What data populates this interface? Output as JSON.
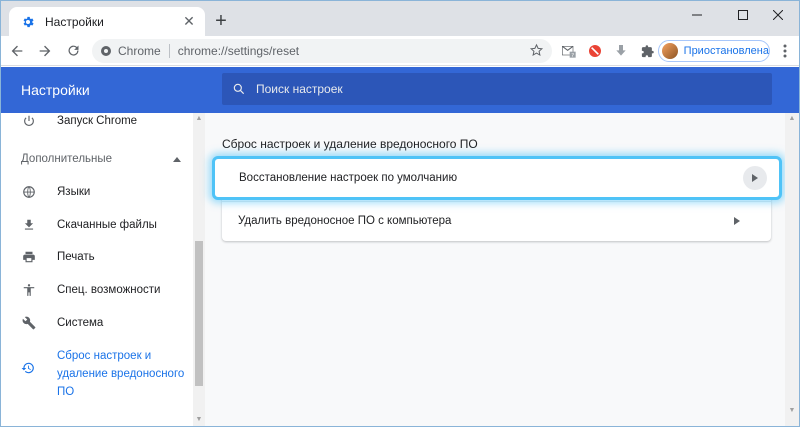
{
  "tab": {
    "title": "Настройки"
  },
  "omnibox": {
    "site": "Chrome",
    "url": "chrome://settings/reset"
  },
  "profile": {
    "label": "Приостановлена"
  },
  "header": {
    "title": "Настройки",
    "search_placeholder": "Поиск настроек"
  },
  "sidebar": {
    "top_item": "Запуск Chrome",
    "advanced": "Дополнительные",
    "items": [
      {
        "label": "Языки",
        "icon": "globe-icon"
      },
      {
        "label": "Скачанные файлы",
        "icon": "download-icon"
      },
      {
        "label": "Печать",
        "icon": "print-icon"
      },
      {
        "label": "Спец. возможности",
        "icon": "accessibility-icon"
      },
      {
        "label": "Система",
        "icon": "wrench-icon"
      }
    ],
    "selected": {
      "line1": "Сброс настроек и",
      "line2": "удаление вредоносного",
      "line3": "ПО",
      "icon": "restore-icon"
    }
  },
  "main": {
    "section_title": "Сброс настроек и удаление вредоносного ПО",
    "rows": [
      {
        "label": "Восстановление настроек по умолчанию"
      },
      {
        "label": "Удалить вредоносное ПО с компьютера"
      }
    ]
  },
  "colors": {
    "header": "#3367d6",
    "accent": "#1a73e8",
    "highlight": "#4fc3f7"
  }
}
